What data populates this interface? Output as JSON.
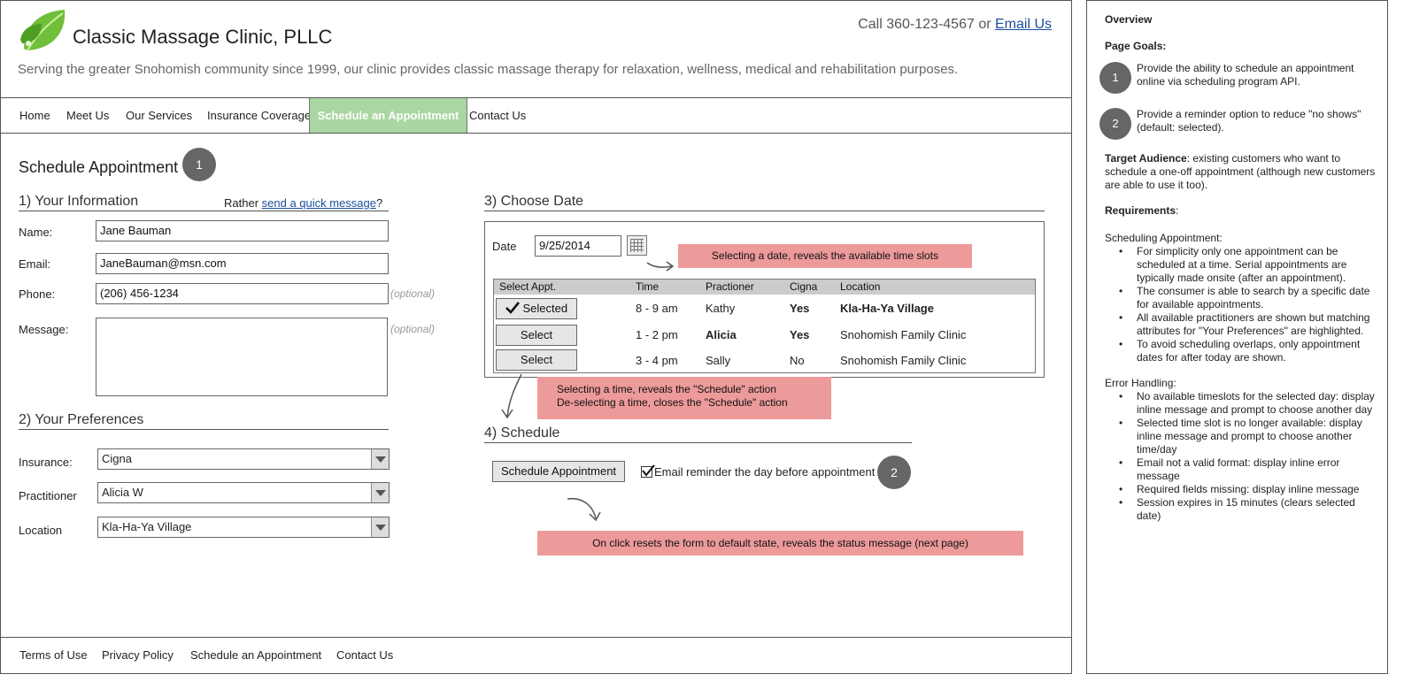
{
  "header": {
    "site_title": "Classic Massage Clinic, PLLC",
    "contact_prefix": "Call 360-123-4567 or ",
    "email_link": "Email Us",
    "tagline": "Serving the greater Snohomish community since 1999, our clinic provides classic massage therapy for relaxation, wellness, medical and rehabilitation purposes."
  },
  "nav": {
    "items": [
      "Home",
      "Meet Us",
      "Our Services",
      "Insurance Coverage",
      "Schedule an Appointment",
      "Contact Us"
    ],
    "active": "Schedule an Appointment"
  },
  "page": {
    "title": "Schedule Appointment",
    "marker_1": "1",
    "marker_2": "2"
  },
  "your_info": {
    "heading": "1) Your Information",
    "rather_prefix": "Rather ",
    "quick_message_link": "send a quick message",
    "rather_suffix": "?",
    "name_label": "Name:",
    "name_value": "Jane Bauman",
    "email_label": "Email:",
    "email_value": "JaneBauman@msn.com",
    "phone_label": "Phone:",
    "phone_value": "(206) 456-1234",
    "message_label": "Message:",
    "optional": "(optional)"
  },
  "preferences": {
    "heading": "2) Your Preferences",
    "insurance_label": "Insurance:",
    "insurance_value": "Cigna",
    "practitioner_label": "Practitioner",
    "practitioner_value": "Alicia W",
    "location_label": "Location",
    "location_value": "Kla-Ha-Ya Village"
  },
  "choose_date": {
    "heading": "3) Choose Date",
    "date_label": "Date",
    "date_value": "9/25/2014",
    "columns": [
      "Select Appt.",
      "Time",
      "Practioner",
      "Cigna",
      "Location"
    ],
    "rows": [
      {
        "button": "Selected",
        "time": "8 - 9 am",
        "practitioner": "Kathy",
        "cigna": "Yes",
        "location": "Kla-Ha-Ya Village"
      },
      {
        "button": "Select",
        "time": "1 - 2 pm",
        "practitioner": "Alicia",
        "cigna": "Yes",
        "location": "Snohomish Family Clinic"
      },
      {
        "button": "Select",
        "time": "3 - 4 pm",
        "practitioner": "Sally",
        "cigna": "No",
        "location": "Snohomish Family Clinic"
      }
    ]
  },
  "schedule": {
    "heading": "4) Schedule",
    "button": "Schedule Appointment",
    "reminder_label": "Email reminder the day before appointment",
    "reminder_checked": true
  },
  "annotations": {
    "date_note": "Selecting a date, reveals the available time slots",
    "time_note_1": "Selecting a time, reveals the \"Schedule\" action",
    "time_note_2": "De-selecting a time, closes the \"Schedule\" action",
    "click_note": "On click resets the form to default state, reveals the status message (next page)"
  },
  "footer": {
    "items": [
      "Terms of Use",
      "Privacy Policy",
      "Schedule an Appointment",
      "Contact Us"
    ]
  },
  "notes": {
    "overview": "Overview",
    "goals_title": "Page Goals:",
    "goal_1": "Provide the ability to schedule an appointment online via scheduling program API.",
    "goal_2": "Provide a reminder option to reduce \"no shows\" (default: selected).",
    "audience_label": "Target Audience",
    "audience_text": ": existing customers who want to schedule a one-off appointment (although new customers are able to use it too).",
    "requirements_label": "Requirements",
    "requirements_suffix": ":",
    "scheduling_title": "Scheduling Appointment:",
    "scheduling_items": [
      "For simplicity only one appointment can be scheduled at a time. Serial appointments are typically made onsite (after an appointment).",
      "The consumer is able to search by a specific date for available appointments.",
      "All available practitioners are shown but matching attributes for \"Your Preferences\" are highlighted.",
      "To avoid scheduling overlaps, only appointment dates for after today are shown."
    ],
    "error_title": "Error Handling:",
    "error_items": [
      "No available timeslots for the selected day: display inline message and prompt to choose another day",
      "Selected time slot is no longer available: display inline message and prompt to  choose another time/day",
      "Email not a valid format: display inline error message",
      "Required fields missing: display inline message",
      "Session expires in 15 minutes (clears selected date)"
    ]
  },
  "colors": {
    "nav_active": "#a9d6a2",
    "annotation": "#ed9a9a",
    "link": "#1a4f9c",
    "marker": "#666666"
  }
}
